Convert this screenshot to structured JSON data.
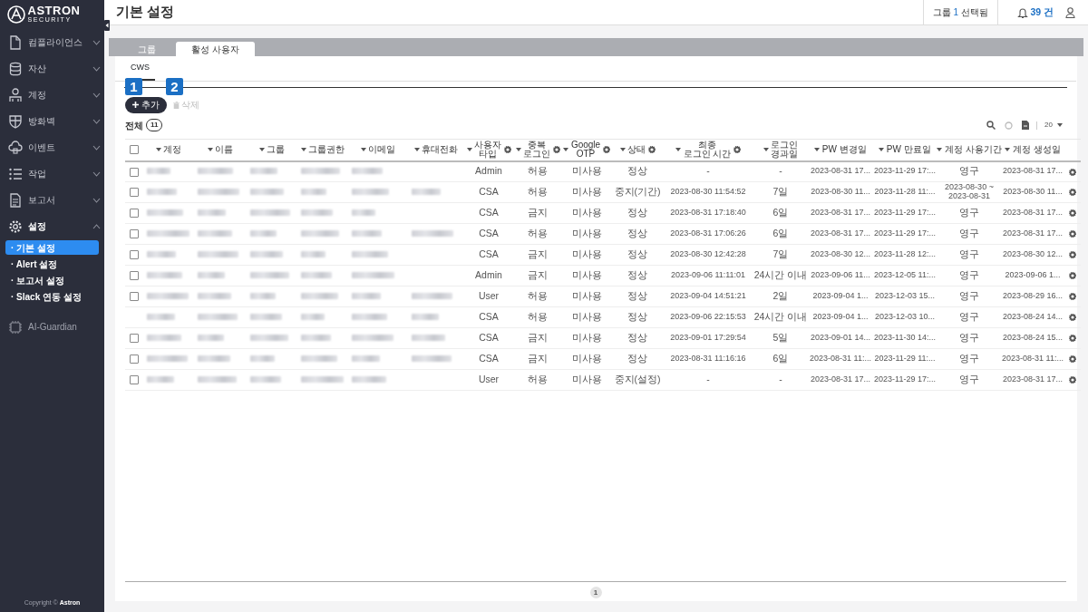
{
  "sidebar": {
    "logo": "ASTRON",
    "logo_sub": "SECURITY",
    "items": [
      {
        "label": "컴플라이언스",
        "expanded": false
      },
      {
        "label": "자산",
        "expanded": false
      },
      {
        "label": "계정",
        "expanded": false
      },
      {
        "label": "방화벽",
        "expanded": false
      },
      {
        "label": "이벤트",
        "expanded": false
      },
      {
        "label": "작업",
        "expanded": false
      },
      {
        "label": "보고서",
        "expanded": false
      },
      {
        "label": "설정",
        "expanded": true,
        "children": [
          {
            "label": "· 기본 설정",
            "selected": true
          },
          {
            "label": "· Alert 설정",
            "selected": false
          },
          {
            "label": "· 보고서 설정",
            "selected": false
          },
          {
            "label": "· Slack 연동 설정",
            "selected": false
          }
        ]
      },
      {
        "label": "AI-Guardian"
      }
    ],
    "copyright": "Copyright © ",
    "copyright_brand": "Astron"
  },
  "header": {
    "title": "기본 설정",
    "group_prefix": "그룹 ",
    "group_count": "1",
    "group_suffix": " 선택됨",
    "alerts": "39 건"
  },
  "tabs": [
    {
      "label": "그룹",
      "selected": false
    },
    {
      "label": "활성 사용자",
      "selected": true
    }
  ],
  "subtabs": [
    {
      "label": "CWS",
      "selected": true
    }
  ],
  "callouts": [
    "1",
    "2"
  ],
  "actions": [
    {
      "label": "추가",
      "disabled": false
    },
    {
      "label": "삭제",
      "disabled": true
    }
  ],
  "total_label": "전체",
  "total_count": "11",
  "page_size": "20",
  "table": {
    "select_all_checked": false,
    "columns": [
      {
        "label": "계정",
        "gear": false
      },
      {
        "label": "이름",
        "gear": false
      },
      {
        "label": "그룹",
        "gear": false
      },
      {
        "label": "그룹권한",
        "gear": false
      },
      {
        "label": "이메일",
        "gear": false
      },
      {
        "label": "휴대전화",
        "gear": false
      },
      {
        "label": "사용자\n타입",
        "gear": true
      },
      {
        "label": "중복\n로그인",
        "gear": true
      },
      {
        "label": "Google\nOTP",
        "gear": true
      },
      {
        "label": "상태",
        "gear": true
      },
      {
        "label": "최종\n로그인 시간",
        "gear": true
      },
      {
        "label": "로그인\n경과일",
        "gear": false
      },
      {
        "label": "PW 변경일",
        "gear": false
      },
      {
        "label": "PW 만료일",
        "gear": false
      },
      {
        "label": "계정 사용기간",
        "gear": false
      },
      {
        "label": "계정 생성일",
        "gear": false
      }
    ],
    "rows": [
      {
        "kind": "checkbox-row",
        "checked": false,
        "cells": [
          null,
          null,
          null,
          null,
          null,
          "",
          "Admin",
          "허용",
          "미사용",
          "정상",
          "-",
          "-",
          "2023-08-31 17...",
          "2023-11-29 17:...",
          "영구",
          "2023-08-31 17..."
        ]
      },
      {
        "kind": "checkbox-row",
        "checked": false,
        "cells": [
          null,
          null,
          null,
          null,
          null,
          null,
          "CSA",
          "허용",
          "미사용",
          "중지(기간)",
          "2023-08-30 11:54:52",
          "7일",
          "2023-08-30 11...",
          "2023-11-28 11:...",
          "2023-08-30 ~\n2023-08-31",
          "2023-08-30 11..."
        ]
      },
      {
        "kind": "checkbox-row",
        "checked": false,
        "cells": [
          null,
          null,
          null,
          null,
          null,
          "",
          "CSA",
          "금지",
          "미사용",
          "정상",
          "2023-08-31 17:18:40",
          "6일",
          "2023-08-31 17...",
          "2023-11-29 17:...",
          "영구",
          "2023-08-31 17..."
        ]
      },
      {
        "kind": "checkbox-row",
        "checked": false,
        "cells": [
          null,
          null,
          null,
          null,
          null,
          null,
          "CSA",
          "허용",
          "미사용",
          "정상",
          "2023-08-31 17:06:26",
          "6일",
          "2023-08-31 17...",
          "2023-11-29 17:...",
          "영구",
          "2023-08-31 17..."
        ]
      },
      {
        "kind": "checkbox-row",
        "checked": false,
        "cells": [
          null,
          null,
          null,
          null,
          null,
          "",
          "CSA",
          "금지",
          "미사용",
          "정상",
          "2023-08-30 12:42:28",
          "7일",
          "2023-08-30 12...",
          "2023-11-28 12:...",
          "영구",
          "2023-08-30 12..."
        ]
      },
      {
        "kind": "checkbox-row",
        "checked": false,
        "cells": [
          null,
          null,
          null,
          null,
          null,
          "",
          "Admin",
          "금지",
          "미사용",
          "정상",
          "2023-09-06 11:11:01",
          "24시간 이내",
          "2023-09-06 11...",
          "2023-12-05 11:...",
          "영구",
          "2023-09-06 1..."
        ]
      },
      {
        "kind": "checkbox-row",
        "checked": false,
        "cells": [
          null,
          null,
          null,
          null,
          null,
          null,
          "User",
          "허용",
          "미사용",
          "정상",
          "2023-09-04 14:51:21",
          "2일",
          "2023-09-04 1...",
          "2023-12-03 15...",
          "영구",
          "2023-08-29 16..."
        ]
      },
      {
        "kind": "plain-row",
        "cells": [
          null,
          null,
          null,
          null,
          null,
          null,
          "CSA",
          "허용",
          "미사용",
          "정상",
          "2023-09-06 22:15:53",
          "24시간 이내",
          "2023-09-04 1...",
          "2023-12-03 10...",
          "영구",
          "2023-08-24 14..."
        ]
      },
      {
        "kind": "checkbox-row",
        "checked": false,
        "cells": [
          null,
          null,
          null,
          null,
          null,
          null,
          "CSA",
          "금지",
          "미사용",
          "정상",
          "2023-09-01 17:29:54",
          "5일",
          "2023-09-01 14...",
          "2023-11-30 14:...",
          "영구",
          "2023-08-24 15..."
        ]
      },
      {
        "kind": "checkbox-row",
        "checked": false,
        "cells": [
          null,
          null,
          null,
          null,
          null,
          null,
          "CSA",
          "금지",
          "미사용",
          "정상",
          "2023-08-31 11:16:16",
          "6일",
          "2023-08-31 11:...",
          "2023-11-29 11:...",
          "영구",
          "2023-08-31 11:..."
        ]
      },
      {
        "kind": "checkbox-row",
        "checked": false,
        "cells": [
          null,
          null,
          null,
          null,
          null,
          "",
          "User",
          "허용",
          "미사용",
          "중지(설정)",
          "-",
          "-",
          "2023-08-31 17...",
          "2023-11-29 17:...",
          "영구",
          "2023-08-31 17..."
        ]
      }
    ]
  },
  "pagination": [
    {
      "label": "1",
      "selected": true
    }
  ]
}
